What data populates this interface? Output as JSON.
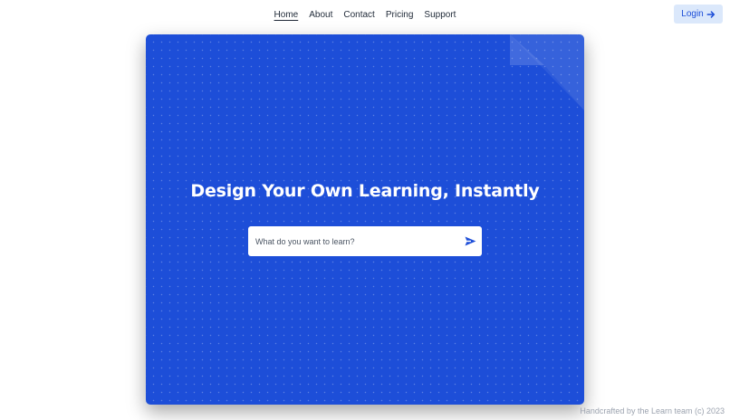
{
  "nav": {
    "items": [
      {
        "label": "Home",
        "active": true
      },
      {
        "label": "About"
      },
      {
        "label": "Contact"
      },
      {
        "label": "Pricing"
      },
      {
        "label": "Support"
      }
    ]
  },
  "login": {
    "label": "Login",
    "icon": "arrow-right-icon"
  },
  "hero": {
    "title": "Design Your Own Learning, Instantly",
    "background_color": "#1d4ed8"
  },
  "search": {
    "value": "",
    "placeholder": "What do you want to learn?",
    "submit_icon": "send-icon"
  },
  "footer": {
    "text": "Handcrafted by the Learn team (c) 2023"
  }
}
